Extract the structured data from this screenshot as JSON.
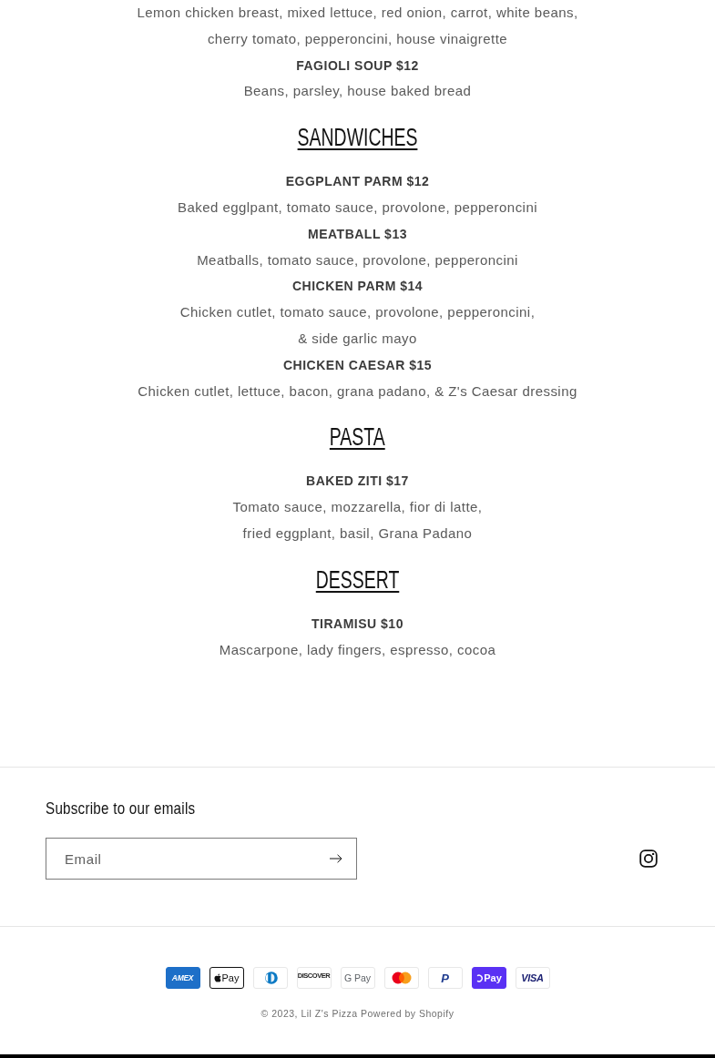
{
  "menu": {
    "sections": [
      {
        "items": [
          {
            "description": [
              "Lemon chicken breast, mixed lettuce, red onion, carrot, white beans,",
              "cherry tomato, pepperoncini, house vinaigrette"
            ]
          },
          {
            "name": "FAGIOLI SOUP $12",
            "description": [
              "Beans, parsley, house baked bread"
            ]
          }
        ]
      },
      {
        "heading": "SANDWICHES",
        "items": [
          {
            "name": "EGGPLANT PARM $12",
            "description": [
              "Baked egglpant, tomato sauce, provolone, pepperoncini"
            ]
          },
          {
            "name": "MEATBALL $13",
            "description": [
              "Meatballs, tomato sauce, provolone, pepperoncini"
            ]
          },
          {
            "name": "CHICKEN PARM $14",
            "description": [
              "Chicken cutlet, tomato sauce, provolone, pepperoncini,",
              "& side garlic mayo"
            ]
          },
          {
            "name": "CHICKEN CAESAR $15",
            "description": [
              "Chicken cutlet, lettuce, bacon, grana padano, & Z's Caesar dressing"
            ]
          }
        ]
      },
      {
        "heading": "PASTA",
        "items": [
          {
            "name": "BAKED ZITI $17",
            "description": [
              "Tomato sauce, mozzarella, fior di latte,",
              "fried eggplant, basil, Grana Padano"
            ]
          }
        ]
      },
      {
        "heading": "DESSERT",
        "items": [
          {
            "name": "TIRAMISU $10",
            "description": [
              "Mascarpone, lady fingers, espresso, cocoa"
            ]
          }
        ]
      }
    ]
  },
  "footer": {
    "newsletter": {
      "heading": "Subscribe to our emails",
      "email_field": {
        "placeholder": "Email"
      }
    },
    "payment_methods": [
      {
        "kind": "amex",
        "label": "AMEX"
      },
      {
        "kind": "apple_pay",
        "label": "Pay"
      },
      {
        "kind": "diners"
      },
      {
        "kind": "discover",
        "label": "DISCOVER"
      },
      {
        "kind": "google_pay",
        "label": "G Pay"
      },
      {
        "kind": "mastercard"
      },
      {
        "kind": "paypal",
        "label": "P"
      },
      {
        "kind": "shop_pay",
        "label": "Pay"
      },
      {
        "kind": "visa",
        "label": "VISA"
      }
    ],
    "copyright": {
      "text": "© 2023,",
      "store_link": "Lil Z's Pizza",
      "powered_by": "Powered by Shopify"
    }
  }
}
